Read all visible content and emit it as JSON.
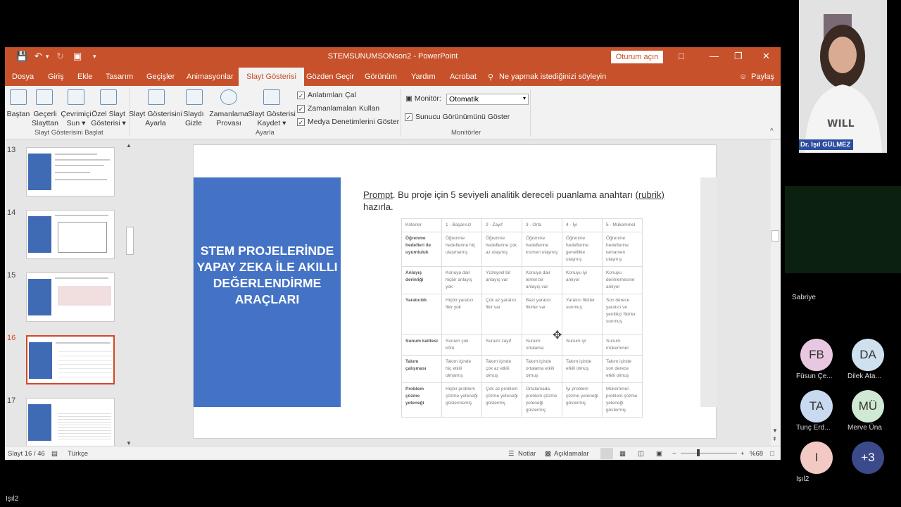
{
  "window": {
    "title": "STEMSUNUMSONson2 - PowerPoint",
    "signin_label": "Oturum açın"
  },
  "menu": {
    "tabs": [
      "Dosya",
      "Giriş",
      "Ekle",
      "Tasarım",
      "Geçişler",
      "Animasyonlar",
      "Slayt Gösterisi",
      "Gözden Geçir",
      "Görünüm",
      "Yardım",
      "Acrobat"
    ],
    "tell_me": "Ne yapmak istediğinizi söyleyin",
    "share": "Paylaş"
  },
  "ribbon": {
    "start_group": {
      "buttons": [
        {
          "line1": "Baştan",
          "line2": ""
        },
        {
          "line1": "Geçerli",
          "line2": "Slayttan"
        },
        {
          "line1": "Çevrimiçi",
          "line2": "Sun ▾"
        },
        {
          "line1": "Özel Slayt",
          "line2": "Gösterisi ▾"
        }
      ],
      "label": "Slayt Gösterisini Başlat"
    },
    "setup_group": {
      "buttons": [
        {
          "line1": "Slayt Gösterisini",
          "line2": "Ayarla"
        },
        {
          "line1": "Slaydı",
          "line2": "Gizle"
        },
        {
          "line1": "Zamanlama",
          "line2": "Provası"
        },
        {
          "line1": "Slayt Gösterisi",
          "line2": "Kaydet ▾"
        }
      ],
      "checkboxes": [
        "Anlatımları Çal",
        "Zamanlamaları Kullan",
        "Medya Denetimlerini Göster"
      ],
      "label": "Ayarla"
    },
    "monitors_group": {
      "monitor_label": "Monitör:",
      "monitor_value": "Otomatik",
      "presenter_view": "Sunucu Görünümünü Göster",
      "label": "Monitörler"
    }
  },
  "thumbnails": {
    "numbers": [
      "13",
      "14",
      "15",
      "16",
      "17"
    ],
    "selected": "16",
    "mini_title": "STEM PROJELERİNDE YAPAY ZEKA İLE AKILLI DEĞERLENDİRME ARAÇLARI"
  },
  "slide": {
    "title": "STEM PROJELERİNDE YAPAY ZEKA İLE AKILLI DEĞERLENDİRME ARAÇLARI",
    "prompt_word": "Prompt",
    "prompt_text": ". Bu proje için 5 seviyeli analitik dereceli puanlama anahtarı",
    "prompt_rubrik": "(rubrik)",
    "prompt_tail": " hazırla.",
    "table": {
      "header": [
        "Kriterler",
        "1 - Başarısız",
        "2 - Zayıf",
        "3 - Orta",
        "4 - İyi",
        "5 - Mükemmel"
      ],
      "rows": [
        [
          "Öğrenme hedefleri ile uyumluluk",
          "Öğrenme hedeflerine hiç ulaşmamış",
          "Öğrenme hedeflerine çok az ulaşmış",
          "Öğrenme hedeflerine kısmen ulaşmış",
          "Öğrenme hedeflerine genellikle ulaşmış",
          "Öğrenme hedeflerine tamamen ulaşmış"
        ],
        [
          "Anlayış derinliği",
          "Konuya dair hiçbir anlayış yok",
          "Yüzeysel bir anlayış var",
          "Konuya dair temel bir anlayış var",
          "Konuyu iyi anlıyor",
          "Konuyu derinlemesine anlıyor"
        ],
        [
          "Yaratıcılık",
          "Hiçbir yaratıcı fikir yok",
          "Çok az yaratıcı fikir var",
          "Bazı yaratıcı fikirler var",
          "Yaratıcı fikirler sunmuş",
          "Son derece yaratıcı ve yenilikçi fikirler sunmuş"
        ],
        [
          "Sunum kalitesi",
          "Sunum çok kötü",
          "Sunum zayıf",
          "Sunum ortalama",
          "Sunum iyi",
          "Sunum mükemmel"
        ],
        [
          "Takım çalışması",
          "Takım içinde hiç etkili olmamış",
          "Takım içinde çok az etkili olmuş",
          "Takım içinde ortalama etkili olmuş",
          "Takım içinde etkili olmuş",
          "Takım içinde son derece etkili olmuş"
        ],
        [
          "Problem çözme yeteneği",
          "Hiçbir problem çözme yeteneği göstermemiş",
          "Çok az problem çözme yeteneği göstermiş",
          "Ortalamada problem çözme yeteneği göstermiş",
          "İyi problem çözme yeteneği göstermiş",
          "Mükemmel problem çözme yeteneği göstermiş"
        ]
      ]
    }
  },
  "status": {
    "slide_count": "Slayt 16 / 46",
    "language": "Türkçe",
    "notes": "Notlar",
    "comments": "Açıklamalar",
    "zoom": "%68"
  },
  "meeting": {
    "presenter_name": "Dr. Işıl GÜLMEZ",
    "dark_tile_name": "Sabriye",
    "participants": [
      {
        "initials": "FB",
        "name": "Füsun Çe...",
        "color": "#e8c8e0"
      },
      {
        "initials": "DA",
        "name": "Dilek Ata...",
        "color": "#cfe0ee"
      },
      {
        "initials": "TA",
        "name": "Tunç Erd...",
        "color": "#c9daf0"
      },
      {
        "initials": "MÜ",
        "name": "Merve Üna",
        "color": "#cfe9d4"
      },
      {
        "initials": "I",
        "name": "Işıl2",
        "color": "#f3c9c4"
      },
      {
        "initials": "+3",
        "name": "",
        "color": "#3a4a8a"
      }
    ],
    "bottom_label": "Işıl2"
  }
}
